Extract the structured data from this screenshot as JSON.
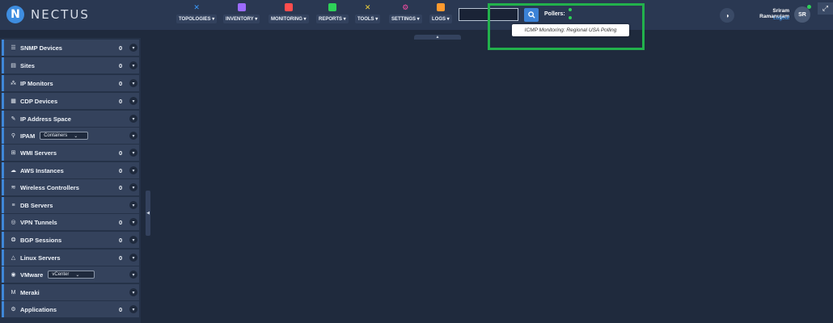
{
  "brand": {
    "name": "NECTUS",
    "mark": "N"
  },
  "nav": [
    {
      "label": "TOPOLOGIES",
      "icon": "topology-icon",
      "color": "#3a9bff"
    },
    {
      "label": "INVENTORY",
      "icon": "inventory-icon",
      "color": "#9c6bff"
    },
    {
      "label": "MONITORING",
      "icon": "monitoring-icon",
      "color": "#ff4d4d"
    },
    {
      "label": "REPORTS",
      "icon": "reports-icon",
      "color": "#2ed158"
    },
    {
      "label": "TOOLS",
      "icon": "tools-icon",
      "color": "#f2d43a"
    },
    {
      "label": "SETTINGS",
      "icon": "settings-icon",
      "color": "#ff4da6"
    },
    {
      "label": "LOGS",
      "icon": "logs-icon",
      "color": "#ff9a2e"
    }
  ],
  "search": {
    "placeholder": ""
  },
  "pollers": {
    "label": "Pollers:",
    "tooltip": "ICMP Monitoring: Regional USA Polling"
  },
  "user": {
    "name": "Sriram Ramanujam",
    "logout": "Logout",
    "initials": "SR"
  },
  "sidebar": [
    {
      "label": "SNMP Devices",
      "count": "0",
      "icon": "server-icon"
    },
    {
      "label": "Sites",
      "count": "0",
      "icon": "sites-icon"
    },
    {
      "label": "IP Monitors",
      "count": "0",
      "icon": "network-icon"
    },
    {
      "label": "CDP Devices",
      "count": "0",
      "icon": "cdp-icon"
    },
    {
      "label": "IP Address Space",
      "count": "",
      "icon": "address-space-icon"
    },
    {
      "label": "IPAM",
      "count": "",
      "icon": "location-icon",
      "select": "Containers"
    },
    {
      "label": "WMI Servers",
      "count": "0",
      "icon": "windows-icon"
    },
    {
      "label": "AWS Instances",
      "count": "0",
      "icon": "cloud-icon"
    },
    {
      "label": "Wireless Controllers",
      "count": "0",
      "icon": "wifi-icon"
    },
    {
      "label": "DB Servers",
      "count": "",
      "icon": "database-icon"
    },
    {
      "label": "VPN Tunnels",
      "count": "0",
      "icon": "vpn-icon"
    },
    {
      "label": "BGP Sessions",
      "count": "0",
      "icon": "bgp-icon"
    },
    {
      "label": "Linux Servers",
      "count": "0",
      "icon": "linux-icon"
    },
    {
      "label": "VMware",
      "count": "",
      "icon": "vmware-icon",
      "select": "vCenter"
    },
    {
      "label": "Meraki",
      "count": "",
      "icon": "meraki-icon"
    },
    {
      "label": "Applications",
      "count": "0",
      "icon": "applications-icon"
    }
  ]
}
